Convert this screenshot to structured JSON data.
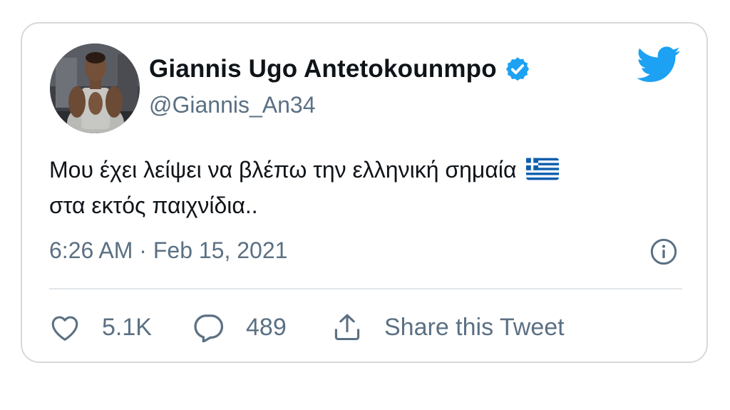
{
  "tweet": {
    "display_name": "Giannis Ugo Antetokounmpo",
    "handle": "@Giannis_An34",
    "verified": true,
    "text_line1": "Μου έχει λείψει να βλέπω την ελληνική σημαία",
    "text_line2": "στα εκτός παιχνίδια..",
    "text_emoji": "greece-flag-emoji",
    "timestamp": "6:26 AM · Feb 15, 2021",
    "likes": "5.1K",
    "replies": "489",
    "share_label": "Share this Tweet"
  },
  "icons": {
    "brand": "twitter-bird-icon",
    "verified": "verified-badge-icon",
    "info": "info-icon",
    "like": "heart-icon",
    "reply": "reply-bubble-icon",
    "share": "share-icon"
  },
  "colors": {
    "twitter_blue": "#1da1f2",
    "text_primary": "#0f1419",
    "text_secondary": "#5b7083",
    "border": "#d6d9dc",
    "divider": "#e1e6ea"
  }
}
